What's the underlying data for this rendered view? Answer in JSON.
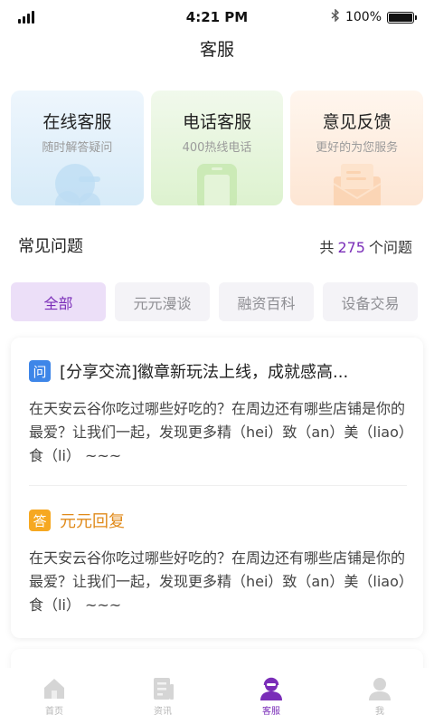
{
  "status_bar": {
    "time": "4:21 PM",
    "battery": "100%",
    "battery_level": 1.0
  },
  "header": {
    "title": "客服"
  },
  "service_cards": [
    {
      "title": "在线客服",
      "subtitle": "随时解答疑问",
      "icon": "chat-bubble-icon",
      "accent": "#9cc8ea"
    },
    {
      "title": "电话客服",
      "subtitle": "400热线电话",
      "icon": "phone-icon",
      "accent": "#b4dc9a"
    },
    {
      "title": "意见反馈",
      "subtitle": "更好的为您服务",
      "icon": "envelope-icon",
      "accent": "#f6c9a1"
    }
  ],
  "faq": {
    "title": "常见问题",
    "count_prefix": "共",
    "count": "275",
    "count_suffix": "个问题"
  },
  "tabs": [
    {
      "label": "全部",
      "active": true
    },
    {
      "label": "元元漫谈",
      "active": false
    },
    {
      "label": "融资百科",
      "active": false
    },
    {
      "label": "设备交易",
      "active": false
    }
  ],
  "qa": {
    "question_badge": "问",
    "question_title": "[分享交流]徽章新玩法上线，成就感高...",
    "question_body": "在天安云谷你吃过哪些好吃的？在周边还有哪些店铺是你的最爱？让我们一起，发现更多精（hei）致（an）美（liao）食（li） ~~~",
    "answer_badge": "答",
    "answer_name": "元元回复",
    "answer_body": "在天安云谷你吃过哪些好吃的？在周边还有哪些店铺是你的最爱？让我们一起，发现更多精（hei）致（an）美（liao）食（li） ~~~"
  },
  "tabbar": [
    {
      "label": "首页",
      "icon": "home-icon",
      "active": false
    },
    {
      "label": "资讯",
      "icon": "news-icon",
      "active": false
    },
    {
      "label": "客服",
      "icon": "customer-service-icon",
      "active": true
    },
    {
      "label": "我",
      "icon": "profile-icon",
      "active": false
    }
  ],
  "colors": {
    "brand": "#7a2db8",
    "question_badge": "#3e86e8",
    "answer_badge": "#f6a821"
  }
}
